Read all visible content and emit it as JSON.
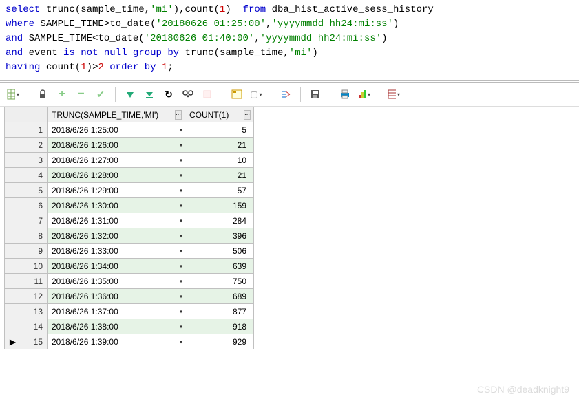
{
  "sql": {
    "lines": [
      [
        {
          "t": "select",
          "c": "kw"
        },
        {
          "t": " "
        },
        {
          "t": "trunc",
          "c": "fn"
        },
        {
          "t": "("
        },
        {
          "t": "sample_time",
          "c": "ident"
        },
        {
          "t": ","
        },
        {
          "t": "'mi'",
          "c": "str"
        },
        {
          "t": "),"
        },
        {
          "t": "count",
          "c": "fn"
        },
        {
          "t": "("
        },
        {
          "t": "1",
          "c": "num"
        },
        {
          "t": ")"
        },
        {
          "t": "  "
        },
        {
          "t": "from",
          "c": "kw"
        },
        {
          "t": " "
        },
        {
          "t": "dba_hist_active_sess_history",
          "c": "ident"
        }
      ],
      [
        {
          "t": "where",
          "c": "kw"
        },
        {
          "t": " "
        },
        {
          "t": "SAMPLE_TIME",
          "c": "ident"
        },
        {
          "t": ">"
        },
        {
          "t": "to_date",
          "c": "fn"
        },
        {
          "t": "("
        },
        {
          "t": "'20180626 01:25:00'",
          "c": "str"
        },
        {
          "t": ","
        },
        {
          "t": "'yyyymmdd hh24:mi:ss'",
          "c": "str"
        },
        {
          "t": ")"
        }
      ],
      [
        {
          "t": "and",
          "c": "kw"
        },
        {
          "t": " "
        },
        {
          "t": "SAMPLE_TIME",
          "c": "ident"
        },
        {
          "t": "<"
        },
        {
          "t": "to_date",
          "c": "fn"
        },
        {
          "t": "("
        },
        {
          "t": "'20180626 01:40:00'",
          "c": "str"
        },
        {
          "t": ","
        },
        {
          "t": "'yyyymmdd hh24:mi:ss'",
          "c": "str"
        },
        {
          "t": ")"
        }
      ],
      [
        {
          "t": "and",
          "c": "kw"
        },
        {
          "t": " "
        },
        {
          "t": "event",
          "c": "ident"
        },
        {
          "t": " "
        },
        {
          "t": "is",
          "c": "kw"
        },
        {
          "t": " "
        },
        {
          "t": "not",
          "c": "kw"
        },
        {
          "t": " "
        },
        {
          "t": "null",
          "c": "kw"
        },
        {
          "t": " "
        },
        {
          "t": "group",
          "c": "kw"
        },
        {
          "t": " "
        },
        {
          "t": "by",
          "c": "kw"
        },
        {
          "t": " "
        },
        {
          "t": "trunc",
          "c": "fn"
        },
        {
          "t": "("
        },
        {
          "t": "sample_time",
          "c": "ident"
        },
        {
          "t": ","
        },
        {
          "t": "'mi'",
          "c": "str"
        },
        {
          "t": ")"
        }
      ],
      [
        {
          "t": "having",
          "c": "kw"
        },
        {
          "t": " "
        },
        {
          "t": "count",
          "c": "fn"
        },
        {
          "t": "("
        },
        {
          "t": "1",
          "c": "num"
        },
        {
          "t": ")"
        },
        {
          "t": ">"
        },
        {
          "t": "2",
          "c": "num"
        },
        {
          "t": " "
        },
        {
          "t": "order",
          "c": "kw"
        },
        {
          "t": " "
        },
        {
          "t": "by",
          "c": "kw"
        },
        {
          "t": " "
        },
        {
          "t": "1",
          "c": "num"
        },
        {
          "t": ";"
        }
      ]
    ]
  },
  "grid": {
    "columns": [
      "TRUNC(SAMPLE_TIME,'MI')",
      "COUNT(1)"
    ],
    "rows": [
      {
        "n": 1,
        "time": "2018/6/26 1:25:00",
        "count": 5
      },
      {
        "n": 2,
        "time": "2018/6/26 1:26:00",
        "count": 21
      },
      {
        "n": 3,
        "time": "2018/6/26 1:27:00",
        "count": 10
      },
      {
        "n": 4,
        "time": "2018/6/26 1:28:00",
        "count": 21
      },
      {
        "n": 5,
        "time": "2018/6/26 1:29:00",
        "count": 57
      },
      {
        "n": 6,
        "time": "2018/6/26 1:30:00",
        "count": 159
      },
      {
        "n": 7,
        "time": "2018/6/26 1:31:00",
        "count": 284
      },
      {
        "n": 8,
        "time": "2018/6/26 1:32:00",
        "count": 396
      },
      {
        "n": 9,
        "time": "2018/6/26 1:33:00",
        "count": 506
      },
      {
        "n": 10,
        "time": "2018/6/26 1:34:00",
        "count": 639
      },
      {
        "n": 11,
        "time": "2018/6/26 1:35:00",
        "count": 750
      },
      {
        "n": 12,
        "time": "2018/6/26 1:36:00",
        "count": 689
      },
      {
        "n": 13,
        "time": "2018/6/26 1:37:00",
        "count": 877
      },
      {
        "n": 14,
        "time": "2018/6/26 1:38:00",
        "count": 918
      },
      {
        "n": 15,
        "time": "2018/6/26 1:39:00",
        "count": 929
      }
    ],
    "current_row_index": 14
  },
  "icons": {
    "grid_dd": "▾",
    "cell_dd": "▾",
    "row_cursor": "▶"
  },
  "watermark": "CSDN @deadknight9"
}
